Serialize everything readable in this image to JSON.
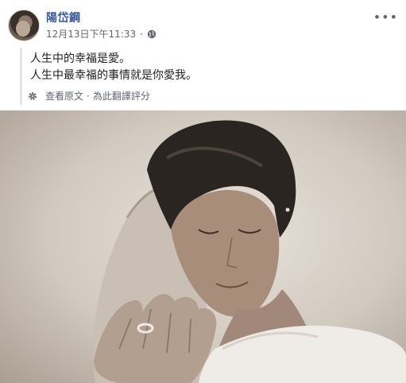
{
  "author": {
    "name": "陽岱鋼"
  },
  "post": {
    "timestamp": "12月13日下午11:33",
    "separator": "·",
    "lines": [
      "人生中的幸福是愛。",
      "人生中最幸福的事情就是你愛我。"
    ],
    "translation": {
      "see_original": "查看原文",
      "separator": "·",
      "rate": "為此翻譯評分"
    }
  },
  "icons": {
    "globe": "globe-icon",
    "more": "more-icon",
    "gear": "gear-icon"
  },
  "colors": {
    "link": "#385898",
    "meta": "#616770",
    "text": "#1c1e21"
  }
}
